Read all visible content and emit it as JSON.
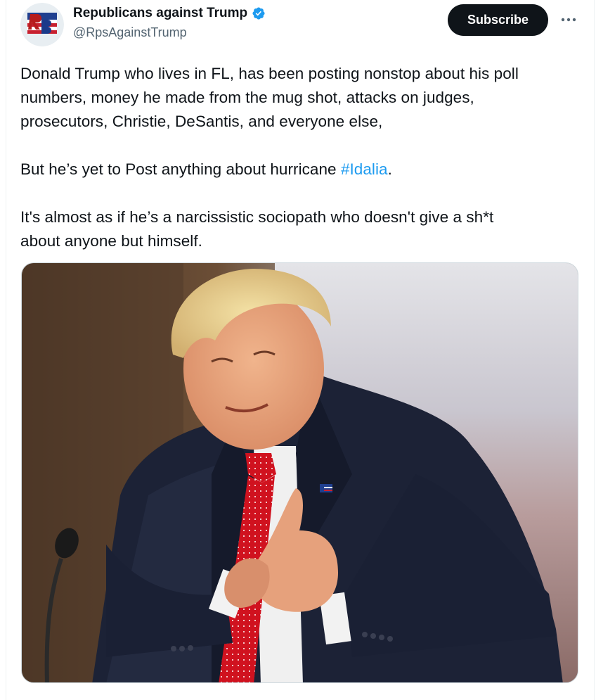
{
  "author": {
    "display_name": "Republicans against Trump",
    "handle": "@RpsAgainstTrump",
    "avatar_letters": "RB",
    "verified": true
  },
  "actions": {
    "subscribe_label": "Subscribe",
    "more_icon": "more-horizontal-icon"
  },
  "tweet": {
    "line1": "Donald Trump who lives in FL, has been posting nonstop about his poll",
    "line2": "numbers, money he made from the mug shot, attacks on judges,",
    "line3": "prosecutors, Christie, DeSantis, and everyone else,",
    "para2_prefix": "But he’s yet to Post anything about hurricane ",
    "hashtag": "#Idalia",
    "para2_suffix": ".",
    "line5": "It's almost as if he’s a narcissistic sociopath who doesn't give a sh*t",
    "line6": "about anyone but himself."
  },
  "colors": {
    "accent": "#1d9bf0",
    "text": "#0f1419",
    "secondary": "#536471",
    "button": "#0f1419"
  }
}
